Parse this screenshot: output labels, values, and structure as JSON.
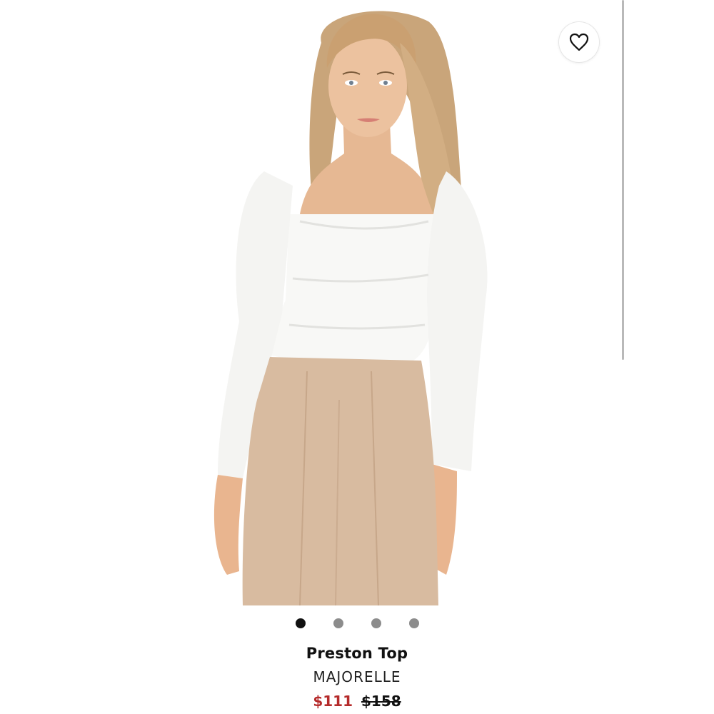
{
  "product": {
    "name": "Preston Top",
    "brand": "MAJORELLE",
    "sale_price": "$111",
    "original_price": "$158",
    "colors": {
      "sale": "#b52a2a",
      "text": "#111111"
    }
  },
  "gallery": {
    "image_count": 4,
    "active_index": 0
  },
  "favorite": {
    "icon": "heart-icon"
  }
}
